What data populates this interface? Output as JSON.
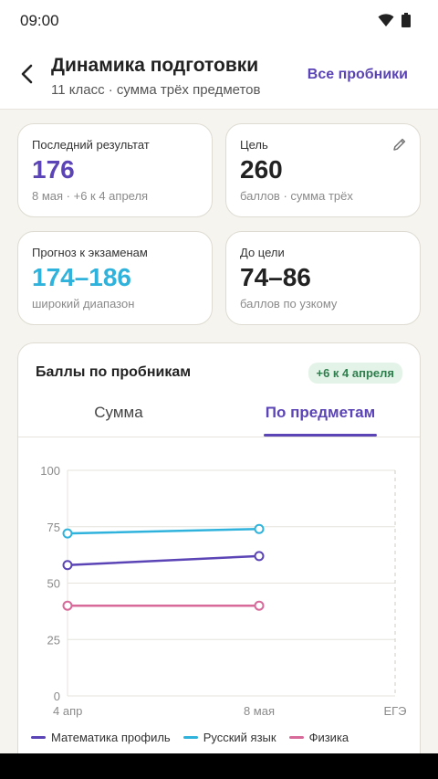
{
  "status": {
    "time": "09:00"
  },
  "header": {
    "title": "Динамика подготовки",
    "subtitle": "11 класс · сумма трёх предметов",
    "all_tests": "Все пробники"
  },
  "cards": {
    "last": {
      "label": "Последний результат",
      "value": "176",
      "note": "8 мая · +6 к 4 апреля"
    },
    "goal": {
      "label": "Цель",
      "value": "260",
      "note": "баллов · сумма трёх"
    },
    "forecast": {
      "label": "Прогноз к экзаменам",
      "value": "174–186",
      "note": "широкий диапазон"
    },
    "to_goal": {
      "label": "До цели",
      "value": "74–86",
      "note": "баллов по узкому"
    }
  },
  "chart_card": {
    "title": "Баллы по пробникам",
    "badge": "+6 к 4 апреля",
    "tabs": [
      {
        "label": "Сумма"
      },
      {
        "label": "По предметам"
      }
    ],
    "active_tab": 1
  },
  "colors": {
    "accent": "#5b44b5",
    "forecast": "#2fb3dc",
    "math": "#5b44b5",
    "russian": "#2fb3dc",
    "physics": "#d86a9a"
  },
  "chart_data": {
    "type": "line",
    "categories": [
      "4 апр",
      "8 мая",
      "ЕГЭ"
    ],
    "yticks": [
      0,
      25,
      50,
      75,
      100
    ],
    "ylim": [
      0,
      100
    ],
    "grid": true,
    "legend": "bottom",
    "series": [
      {
        "name": "Математика профиль",
        "values": [
          58,
          62
        ],
        "color": "#5b44b5"
      },
      {
        "name": "Русский язык",
        "values": [
          72,
          74
        ],
        "color": "#2fb3dc"
      },
      {
        "name": "Физика",
        "values": [
          40,
          40
        ],
        "color": "#d86a9a"
      }
    ]
  }
}
